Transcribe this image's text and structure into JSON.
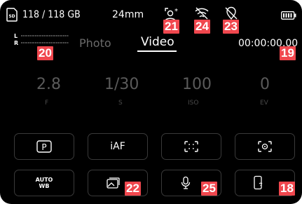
{
  "status_bar": {
    "storage": "118 / 118 GB",
    "focal_length": "24mm",
    "timecode": "00:00:00,00"
  },
  "audio_meter": {
    "left_label": "L",
    "right_label": "R"
  },
  "tabs": [
    {
      "label": "Photo",
      "selected": false
    },
    {
      "label": "Video",
      "selected": true
    }
  ],
  "exposure": [
    {
      "value": "2.8",
      "label": "F"
    },
    {
      "value": "1/30",
      "label": "S"
    },
    {
      "value": "100",
      "label": "ISO"
    },
    {
      "value": "0",
      "label": "EV"
    }
  ],
  "buttons_row1": [
    {
      "icon": "p-mode-icon"
    },
    {
      "label": "iAF"
    },
    {
      "icon": "focus-frame-icon"
    },
    {
      "icon": "metering-icon"
    }
  ],
  "buttons_row2": [
    {
      "label_line1": "AUTO",
      "label_line2": "WB"
    },
    {
      "icon": "gallery-icon"
    },
    {
      "icon": "microphone-icon"
    },
    {
      "icon": "smartphone-connect-icon"
    }
  ],
  "callouts": [
    "21",
    "24",
    "23",
    "20",
    "19",
    "22",
    "25",
    "18"
  ],
  "colors": {
    "callout": "#f0474e",
    "background": "#000000",
    "text": "#ffffff",
    "dim_text": "#4a4a4a"
  }
}
